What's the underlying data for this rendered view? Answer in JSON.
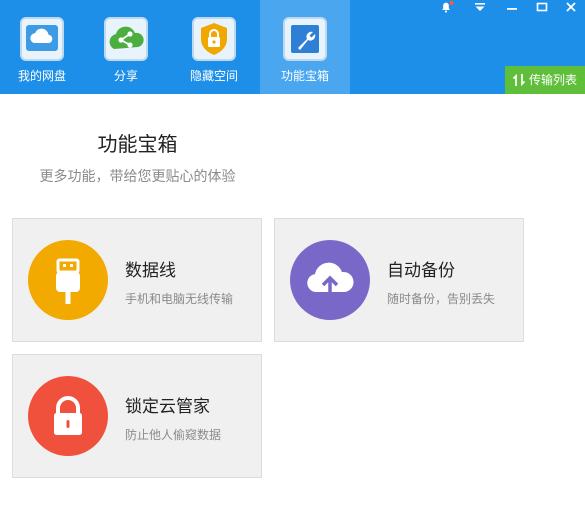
{
  "nav": {
    "items": [
      {
        "label": "我的网盘",
        "icon": "cloud-drive-icon",
        "active": false
      },
      {
        "label": "分享",
        "icon": "share-icon",
        "active": false
      },
      {
        "label": "隐藏空间",
        "icon": "lock-shield-icon",
        "active": false
      },
      {
        "label": "功能宝箱",
        "icon": "wrench-toolbox-icon",
        "active": true
      }
    ]
  },
  "window_controls": [
    "bell-icon",
    "dropdown-icon",
    "minimize-icon",
    "maximize-icon",
    "close-icon"
  ],
  "transfer": {
    "label": "传输列表",
    "icon": "transfer-arrows-icon"
  },
  "main": {
    "title": "功能宝箱",
    "subtitle": "更多功能，带给您更贴心的体验"
  },
  "cards": [
    {
      "title": "数据线",
      "desc": "手机和电脑无线传输",
      "icon": "usb-icon",
      "color": "#f2a900"
    },
    {
      "title": "自动备份",
      "desc": "随时备份，告别丢失",
      "icon": "cloud-upload-icon",
      "color": "#7a68c8"
    },
    {
      "title": "锁定云管家",
      "desc": "防止他人偷窥数据",
      "icon": "padlock-icon",
      "color": "#f0513c"
    }
  ],
  "colors": {
    "topbar": "#1e8fe8",
    "active_tab": "#4aa6ee",
    "transfer_button": "#5fbf3b",
    "card_bg": "#f0f0f0"
  }
}
